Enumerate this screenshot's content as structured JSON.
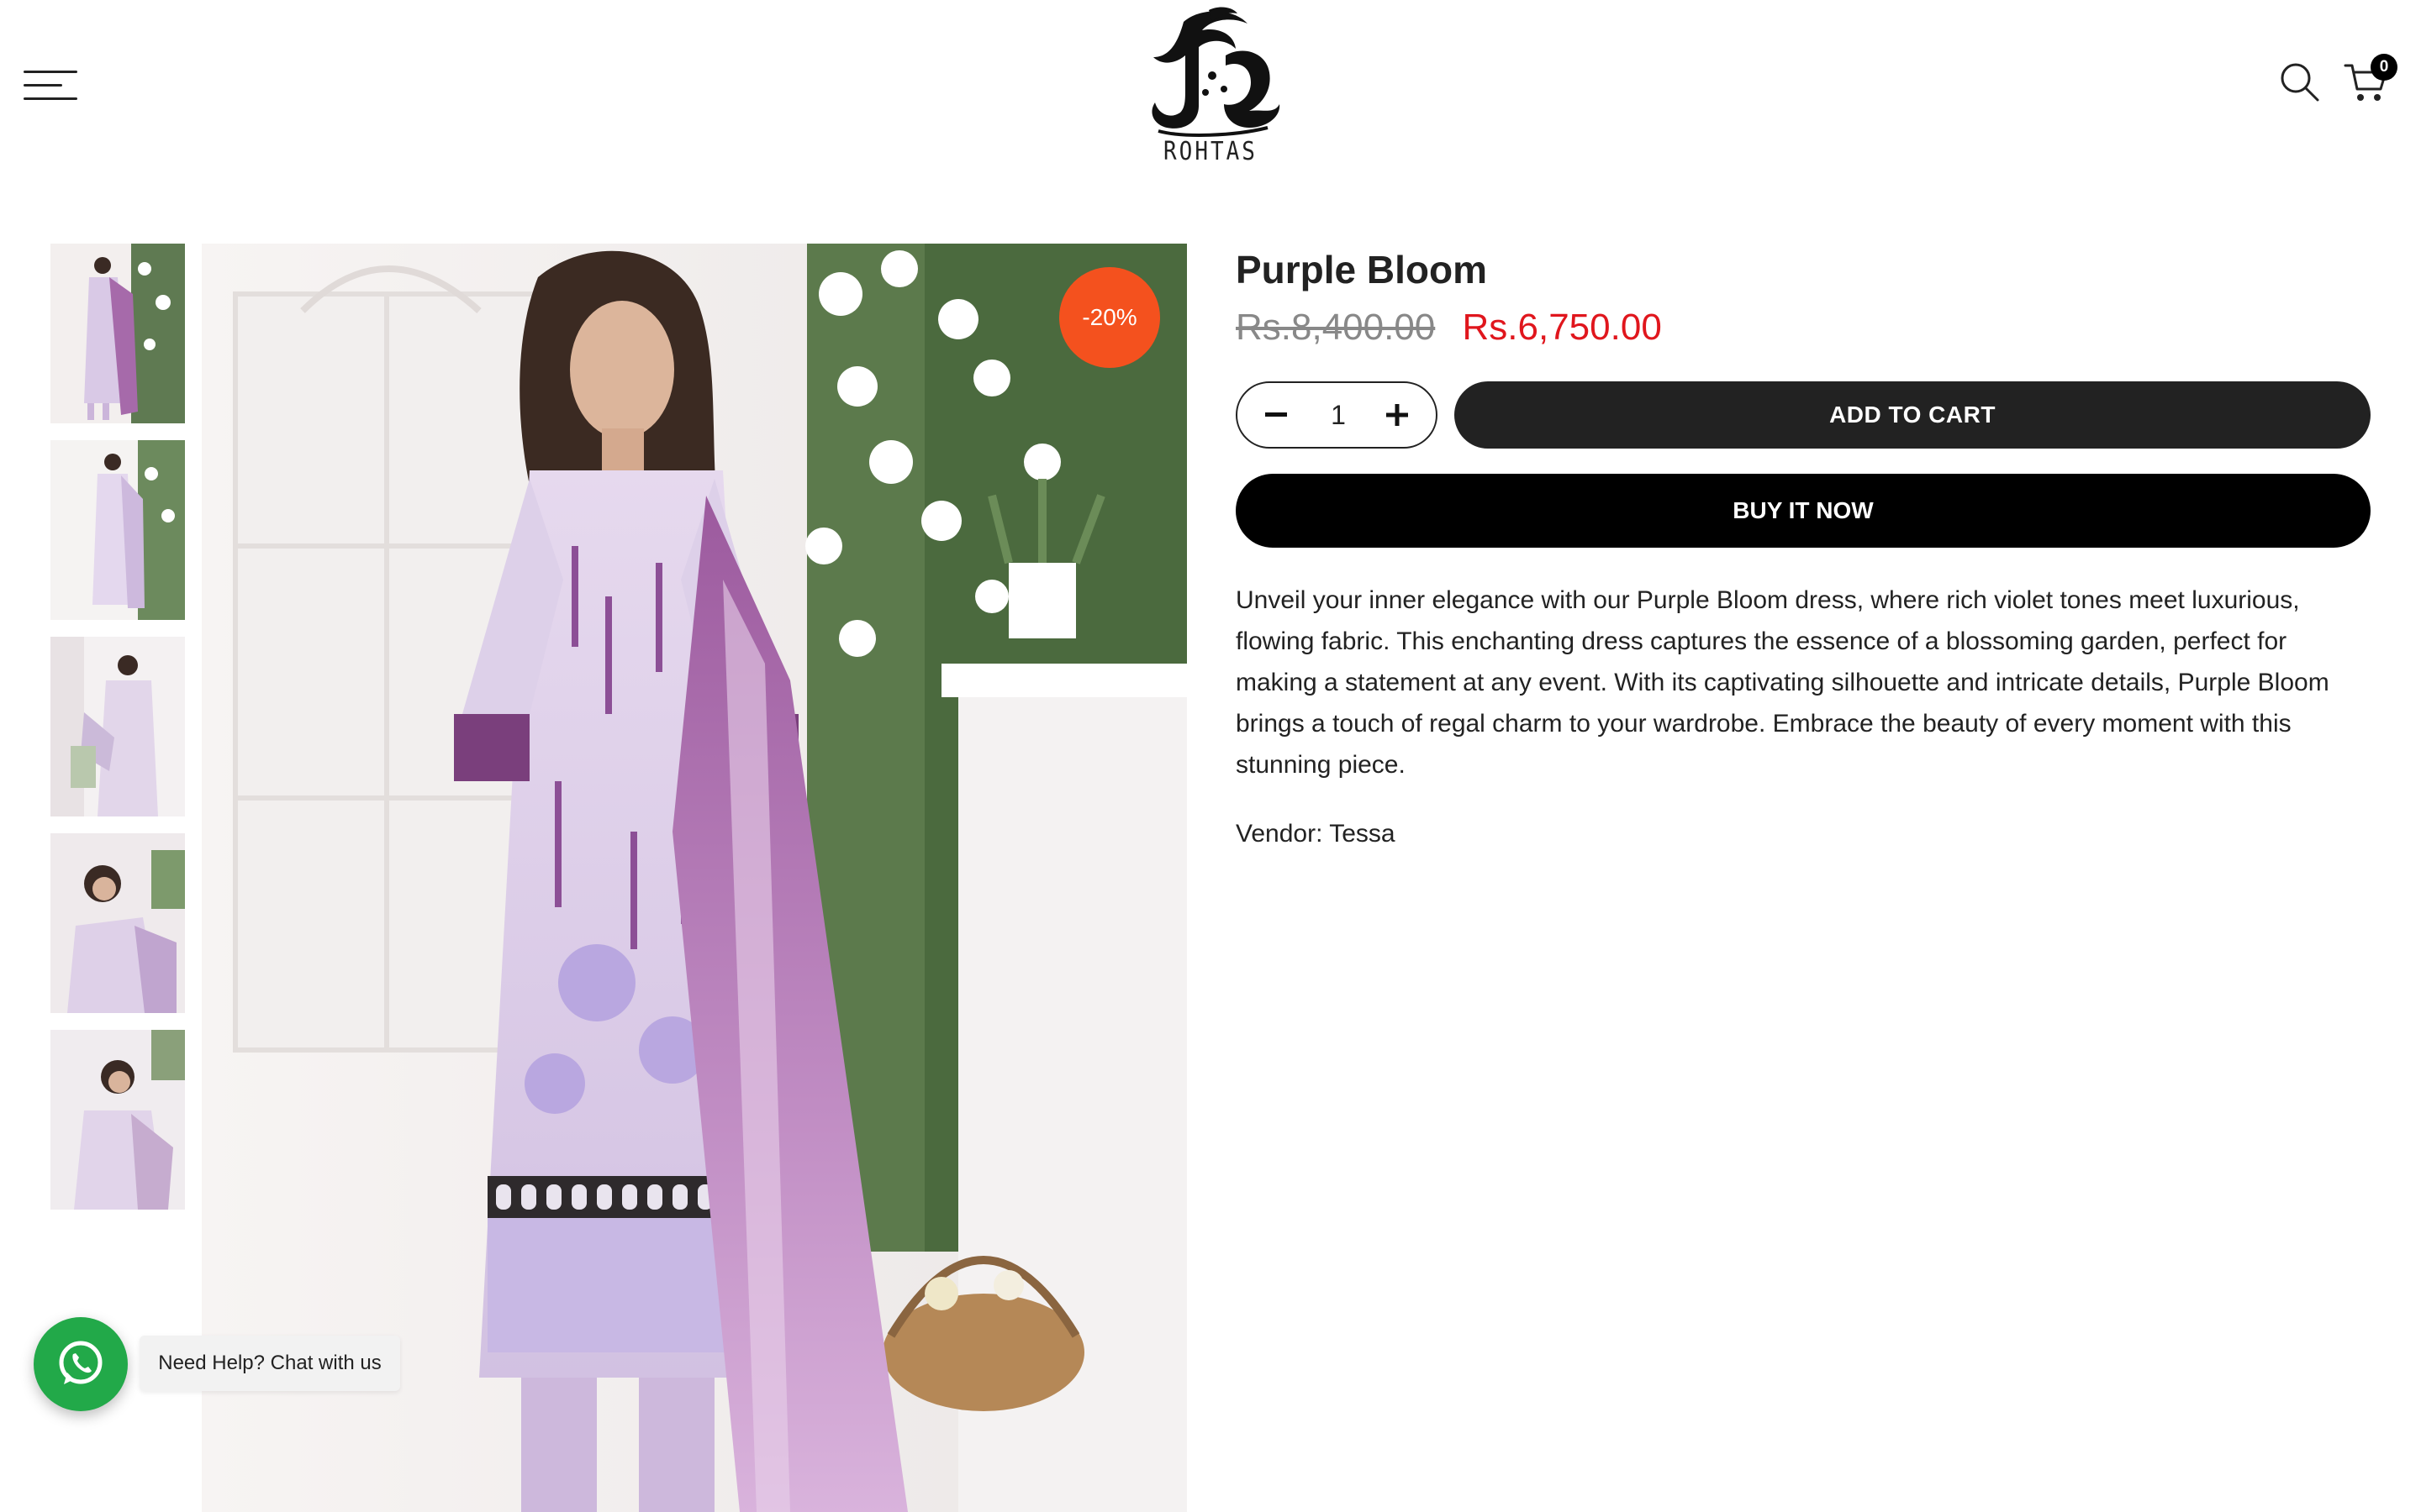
{
  "header": {
    "menu_icon": "hamburger-menu-icon",
    "logo_text": "ROHTAS",
    "search_icon": "search-icon",
    "cart_icon": "cart-icon",
    "cart_count": "0"
  },
  "gallery": {
    "thumbnail_count": 5,
    "sale_badge": "-20%"
  },
  "product": {
    "title": "Purple Bloom",
    "price_old": "Rs.8,400.00",
    "price_new": "Rs.6,750.00",
    "quantity": "1",
    "minus_label": "−",
    "plus_label": "+",
    "add_to_cart_label": "ADD TO CART",
    "buy_now_label": "BUY IT NOW",
    "description": "Unveil your inner elegance with our Purple Bloom dress, where rich violet tones meet luxurious, flowing fabric. This enchanting dress captures the essence of a blossoming garden, perfect for making a statement at any event. With its captivating silhouette and intricate details, Purple Bloom brings a touch of regal charm to your wardrobe. Embrace the beauty of every moment with this stunning piece.",
    "vendor_label": "Vendor:",
    "vendor_name": "Tessa"
  },
  "chat": {
    "icon": "whatsapp-icon",
    "label": "Need Help? Chat with us"
  },
  "colors": {
    "accent_sale": "#f4511e",
    "price_new": "#e0161d",
    "button_dark": "#222222",
    "whatsapp": "#22a949"
  }
}
